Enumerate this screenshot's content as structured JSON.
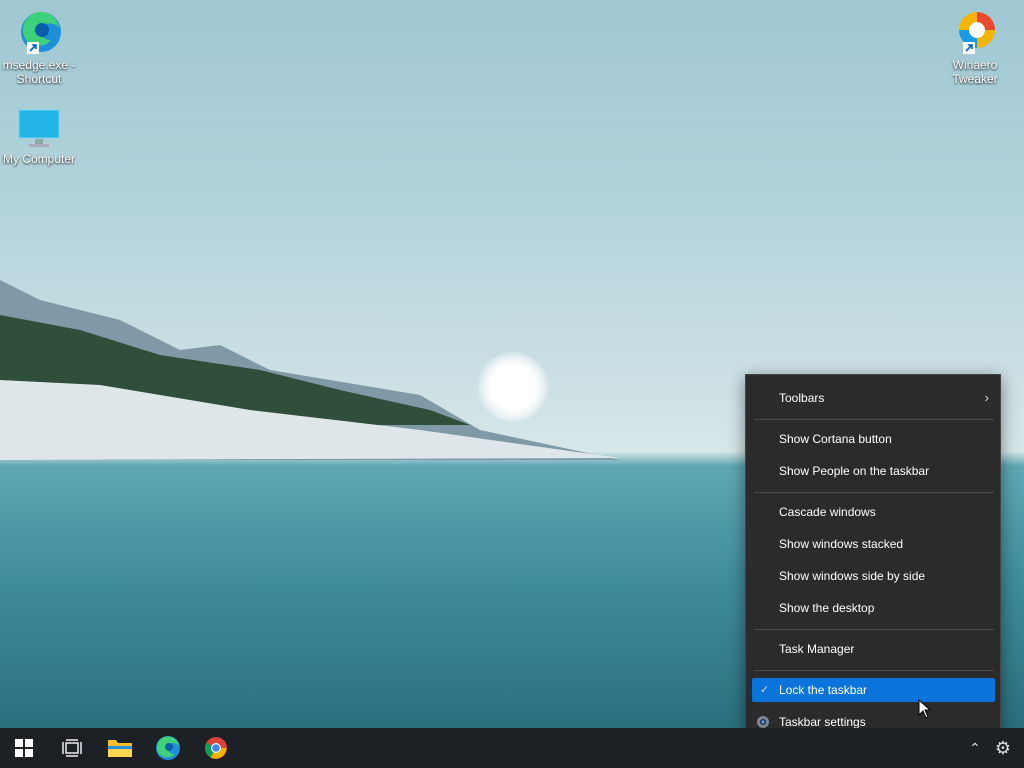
{
  "desktop": {
    "icons": [
      {
        "name": "msedge-shortcut",
        "label": "msedge.exe - Shortcut",
        "line1": "msedge.exe -",
        "line2": "Shortcut"
      },
      {
        "name": "my-computer",
        "label": "My Computer"
      },
      {
        "name": "winaero-tweaker",
        "label": "Winaero Tweaker",
        "line1": "Winaero",
        "line2": "Tweaker"
      }
    ]
  },
  "context_menu": {
    "items": [
      {
        "id": "toolbars",
        "label": "Toolbars",
        "has_submenu": true
      },
      {
        "id": "show-cortana",
        "label": "Show Cortana button"
      },
      {
        "id": "show-people",
        "label": "Show People on the taskbar"
      },
      {
        "id": "cascade",
        "label": "Cascade windows"
      },
      {
        "id": "stacked",
        "label": "Show windows stacked"
      },
      {
        "id": "side-by-side",
        "label": "Show windows side by side"
      },
      {
        "id": "show-desktop",
        "label": "Show the desktop"
      },
      {
        "id": "task-manager",
        "label": "Task Manager"
      },
      {
        "id": "lock-taskbar",
        "label": "Lock the taskbar",
        "checked": true,
        "highlighted": true
      },
      {
        "id": "taskbar-settings",
        "label": "Taskbar settings"
      }
    ]
  },
  "taskbar": {
    "buttons": [
      "start",
      "task-view",
      "file-explorer",
      "edge",
      "chrome"
    ],
    "tray": [
      "chevron-up",
      "gear"
    ]
  },
  "colors": {
    "menu_bg": "#2b2b2b",
    "highlight": "#0a74da",
    "taskbar_bg": "#1d2024"
  }
}
